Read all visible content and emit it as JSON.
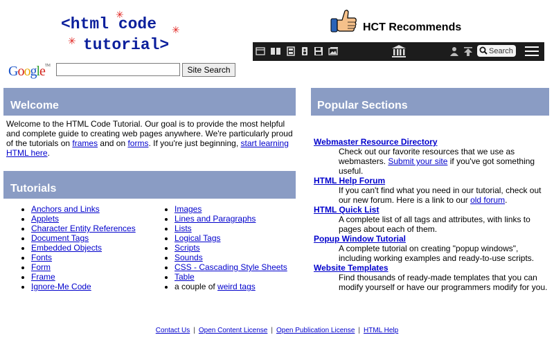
{
  "logo": {
    "line1": "<html code",
    "line2": "tutorial>"
  },
  "google": {
    "logo_text": "Google",
    "search_value": "",
    "search_button": "Site Search"
  },
  "recommend": {
    "title": "HCT Recommends"
  },
  "toolbar": {
    "icons": [
      "window-icon",
      "book-icon",
      "film-icon",
      "speaker-icon",
      "save-icon",
      "image-icon",
      "library-icon",
      "person-icon",
      "upload-icon"
    ],
    "search_label": "Search"
  },
  "welcome": {
    "heading": "Welcome",
    "text_1": "Welcome to the HTML Code Tutorial. Our goal is to provide the most helpful and complete guide to creating web pages anywhere. We're particularly proud of the tutorials on ",
    "link_frames": "frames",
    "text_2": " and on ",
    "link_forms": "forms",
    "text_3": ".  If you're just beginning, ",
    "link_start": "start learning HTML here",
    "text_4": "."
  },
  "tutorials": {
    "heading": "Tutorials",
    "col1": [
      "Anchors and Links",
      "Applets",
      "Character Entity References",
      "Document Tags",
      "Embedded Objects",
      "Fonts",
      "Form",
      "Frame",
      "Ignore-Me Code"
    ],
    "col2": [
      "Images",
      "Lines and Paragraphs",
      "Lists",
      "Logical Tags",
      "Scripts",
      "Sounds",
      "CSS - Cascading Style Sheets",
      "Table"
    ],
    "col2_last_prefix": "a couple of ",
    "col2_last_link": "weird tags"
  },
  "popular": {
    "heading": "Popular Sections",
    "items": [
      {
        "title": "Webmaster Resource Directory",
        "desc": "Check out our favorite resources that we use as webmasters.  ",
        "link": "Submit your site",
        "desc_after": " if you've got something useful."
      },
      {
        "title": "HTML Help Forum",
        "desc": "If you can't find what you need in our tutorial, check out our new forum. Here is a link to our ",
        "link": "old forum",
        "desc_after": "."
      },
      {
        "title": "HTML Quick List",
        "desc": "A complete list of all tags and attributes, with links to pages about each of them.",
        "link": "",
        "desc_after": ""
      },
      {
        "title": "Popup Window Tutorial",
        "desc": "A complete tutorial on creating \"popup windows\", including working examples and ready-to-use scripts.",
        "link": "",
        "desc_after": ""
      },
      {
        "title": "Website Templates",
        "desc": "Find thousands of ready-made templates that you can modify yourself or have our programmers modify for you.",
        "link": "",
        "desc_after": ""
      }
    ]
  },
  "footer": {
    "links": [
      "Contact Us",
      "Open Content License",
      "Open Publication License",
      "HTML Help"
    ],
    "separator": "|"
  },
  "colors": {
    "section_header": "#8a9cc4",
    "link": "#0000cc",
    "toolbar": "#1c1c1c",
    "logo_blue": "#0b1f9c",
    "logo_red": "#e0201c"
  }
}
